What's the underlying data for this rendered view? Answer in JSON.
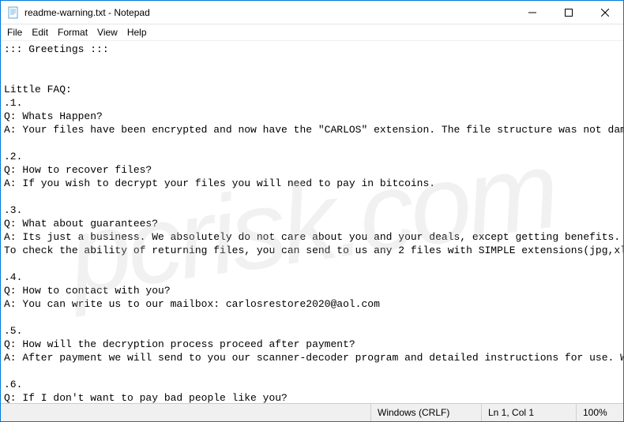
{
  "window": {
    "title": "readme-warning.txt - Notepad"
  },
  "menu": {
    "file": "File",
    "edit": "Edit",
    "format": "Format",
    "view": "View",
    "help": "Help"
  },
  "content": {
    "text": "::: Greetings :::\n\n\nLittle FAQ:\n.1.\nQ: Whats Happen?\nA: Your files have been encrypted and now have the \"CARLOS\" extension. The file structure was not damaged\n\n.2.\nQ: How to recover files?\nA: If you wish to decrypt your files you will need to pay in bitcoins.\n\n.3.\nQ: What about guarantees?\nA: Its just a business. We absolutely do not care about you and your deals, except getting benefits. If w\nTo check the ability of returning files, you can send to us any 2 files with SIMPLE extensions(jpg,xls,do\n\n.4.\nQ: How to contact with you?\nA: You can write us to our mailbox: carlosrestore2020@aol.com\n\n.5.\nQ: How will the decryption process proceed after payment?\nA: After payment we will send to you our scanner-decoder program and detailed instructions for use. With \n\n.6.\nQ: If I don't want to pay bad people like you?\nA: If you will not cooperate with our service - for us, its does not matter. But you will lose your time "
  },
  "statusbar": {
    "line_ending": "Windows (CRLF)",
    "position": "Ln 1, Col 1",
    "zoom": "100%"
  },
  "watermark": "pcrisk.com"
}
